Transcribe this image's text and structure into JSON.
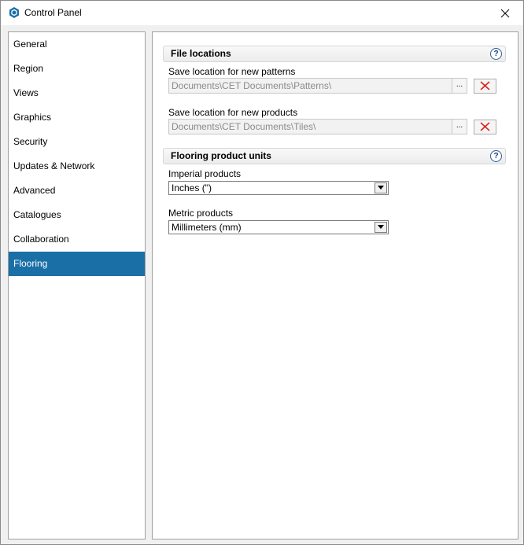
{
  "window": {
    "title": "Control Panel",
    "app_icon": "cet-logo-icon",
    "close_icon": "close-icon"
  },
  "sidebar": {
    "items": [
      {
        "label": "General",
        "active": false
      },
      {
        "label": "Region",
        "active": false
      },
      {
        "label": "Views",
        "active": false
      },
      {
        "label": "Graphics",
        "active": false
      },
      {
        "label": "Security",
        "active": false
      },
      {
        "label": "Updates & Network",
        "active": false
      },
      {
        "label": "Advanced",
        "active": false
      },
      {
        "label": "Catalogues",
        "active": false
      },
      {
        "label": "Collaboration",
        "active": false
      },
      {
        "label": "Flooring",
        "active": true
      }
    ]
  },
  "file_locations": {
    "title": "File locations",
    "help": "?",
    "patterns": {
      "label": "Save location for new patterns",
      "value": "Documents\\CET Documents\\Patterns\\",
      "browse": "..."
    },
    "products": {
      "label": "Save location for new products",
      "value": "Documents\\CET Documents\\Tiles\\",
      "browse": "..."
    }
  },
  "units": {
    "title": "Flooring product units",
    "help": "?",
    "imperial": {
      "label": "Imperial products",
      "value": "Inches (\")"
    },
    "metric": {
      "label": "Metric products",
      "value": "Millimeters (mm)"
    }
  },
  "colors": {
    "accent": "#1a6fa6",
    "clear_x": "#d9261c"
  }
}
